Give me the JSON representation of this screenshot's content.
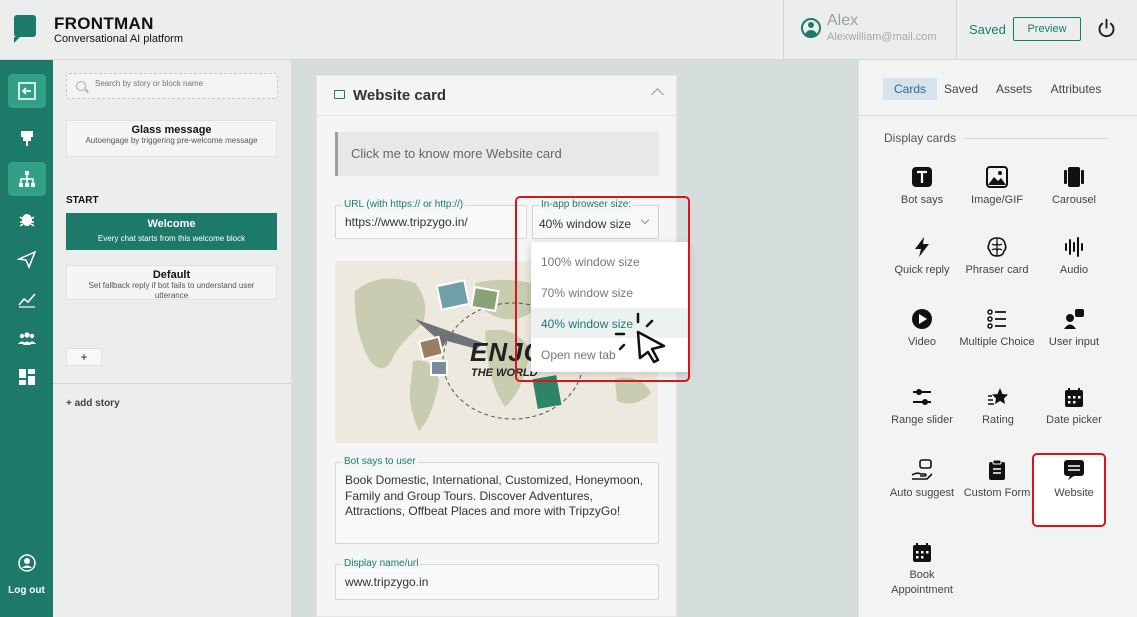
{
  "app": {
    "brand": "FRONTMAN",
    "tagline": "Conversational AI platform"
  },
  "user": {
    "name": "Alex",
    "email": "Alexwilliam@mail.com"
  },
  "header": {
    "status": "Saved",
    "preview_label": "Preview"
  },
  "rail": {
    "logout_label": "Log out",
    "icons": [
      "collapse-icon",
      "pin-icon",
      "hierarchy-icon",
      "bug-icon",
      "send-icon",
      "analytics-icon",
      "users-icon",
      "dashboard-icon"
    ]
  },
  "stories": {
    "search_placeholder": "Search by story or block name",
    "glass": {
      "title": "Glass message",
      "sub": "Autoengage by triggering pre-welcome message"
    },
    "start_label": "START",
    "welcome": {
      "title": "Welcome",
      "sub": "Every chat starts from this welcome block"
    },
    "default": {
      "title": "Default",
      "sub": "Set fallback reply if bot fails to understand user utterance"
    },
    "add_label": "+",
    "add_story": "+ add story"
  },
  "card": {
    "title": "Website card",
    "quote": "Click me to know more Website card",
    "url_legend": "URL (with https:// or http://)",
    "url_value": "https://www.tripzygo.in/",
    "size_legend": "In-app browser size:",
    "size_value": "40% window size",
    "image_text_1": "ENJOY",
    "image_text_2": "THE WORLD",
    "bot_says_legend": "Bot says to user",
    "bot_says_value": "Book Domestic, International, Customized, Honeymoon, Family and Group Tours. Discover Adventures, Attractions, Offbeat Places and more with TripzyGo!",
    "display_legend": "Display name/url",
    "display_value": "www.tripzygo.in"
  },
  "dropdown": {
    "options": [
      "100% window size",
      "70% window size",
      "40% window size",
      "Open new tab"
    ],
    "selected": "40% window size"
  },
  "right_panel": {
    "tabs": [
      "Cards",
      "Saved",
      "Assets",
      "Attributes"
    ],
    "active_tab": "Cards",
    "section_label": "Display cards",
    "cards": [
      {
        "label": "Bot says",
        "icon": "text-icon"
      },
      {
        "label": "Image/GIF",
        "icon": "image-icon"
      },
      {
        "label": "Carousel",
        "icon": "carousel-icon"
      },
      {
        "label": "Quick reply",
        "icon": "lightning-icon"
      },
      {
        "label": "Phraser card",
        "icon": "brain-icon"
      },
      {
        "label": "Audio",
        "icon": "audio-icon"
      },
      {
        "label": "Video",
        "icon": "play-icon"
      },
      {
        "label": "Multiple Choice",
        "icon": "list-icon"
      },
      {
        "label": "User input",
        "icon": "user-input-icon"
      },
      {
        "label": "Range slider",
        "icon": "slider-icon"
      },
      {
        "label": "Rating",
        "icon": "star-icon"
      },
      {
        "label": "Date picker",
        "icon": "calendar-icon"
      },
      {
        "label": "Auto suggest",
        "icon": "hand-icon"
      },
      {
        "label": "Custom Form",
        "icon": "form-icon"
      },
      {
        "label": "Website",
        "icon": "website-icon"
      },
      {
        "label": "Book Appointment",
        "icon": "appointment-icon"
      }
    ]
  },
  "colors": {
    "brand": "#1e7a68",
    "accent_active": "#31a087",
    "highlight": "#d8141c"
  }
}
